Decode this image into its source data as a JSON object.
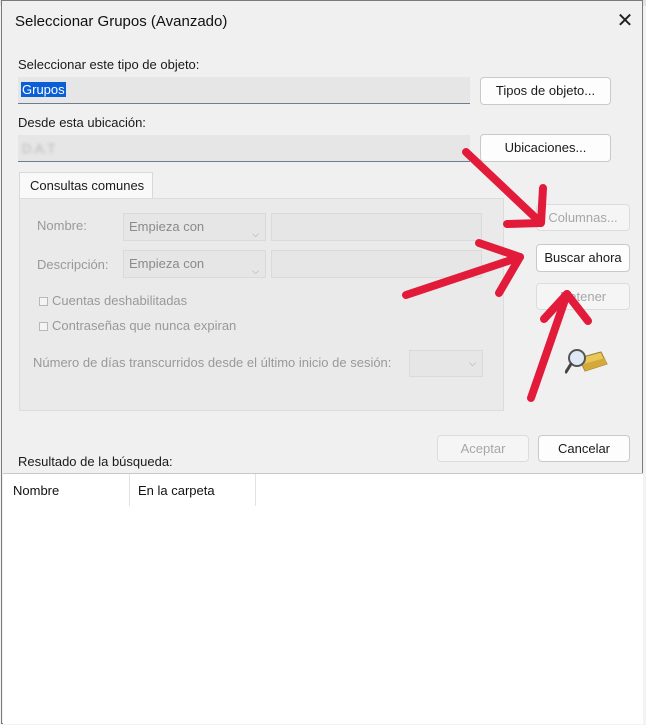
{
  "dialog": {
    "title": "Seleccionar Grupos (Avanzado)",
    "close_glyph": "✕"
  },
  "object_type": {
    "label": "Seleccionar este tipo de objeto:",
    "value": "Grupos",
    "button": "Tipos de objeto..."
  },
  "location": {
    "label": "Desde esta ubicación:",
    "value": "D.A.T",
    "button": "Ubicaciones..."
  },
  "tab": {
    "label": "Consultas comunes"
  },
  "query": {
    "name_label": "Nombre:",
    "name_mode": "Empieza con",
    "desc_label": "Descripción:",
    "desc_mode": "Empieza con",
    "disabled_accounts": "Cuentas deshabilitadas",
    "non_expiring_pw": "Contraseñas que nunca expiran",
    "days_label": "Número de días transcurridos desde el último inicio de sesión:"
  },
  "side_buttons": {
    "columns": "Columnas...",
    "search_now": "Buscar ahora",
    "stop": "Detener"
  },
  "footer": {
    "ok": "Aceptar",
    "cancel": "Cancelar",
    "results_label": "Resultado de la búsqueda:"
  },
  "results_table": {
    "columns": [
      "Nombre",
      "En la carpeta"
    ]
  },
  "colors": {
    "accent_selection": "#0a5fd6",
    "annotation_arrows": "#e21b3a"
  },
  "icons": {
    "search_icon": "magnifier-over-folder-icon",
    "combo_chevron": "chevron-down-icon"
  }
}
